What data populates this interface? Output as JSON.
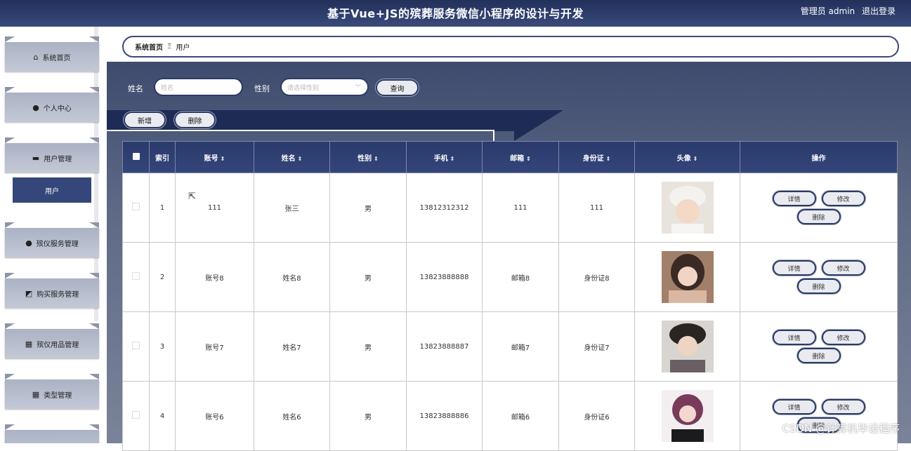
{
  "header": {
    "title": "基于Vue+JS的殡葬服务微信小程序的设计与开发",
    "user_label": "管理员 admin",
    "logout_label": "退出登录"
  },
  "sidebar": {
    "items": [
      {
        "label": "系统首页",
        "icon": "home-icon"
      },
      {
        "label": "个人中心",
        "icon": "user-icon"
      },
      {
        "label": "用户管理",
        "icon": "briefcase-icon"
      },
      {
        "label": "殡仪服务管理",
        "icon": "user-icon"
      },
      {
        "label": "购买服务管理",
        "icon": "chart-icon"
      },
      {
        "label": "殡仪用品管理",
        "icon": "grid-icon"
      },
      {
        "label": "类型管理",
        "icon": "grid-icon"
      }
    ],
    "sub_item": "用户"
  },
  "breadcrumb": {
    "home": "系统首页",
    "separator": "Ξ",
    "current": "用户"
  },
  "search": {
    "name_label": "姓名",
    "name_placeholder": "姓名",
    "gender_label": "性别",
    "gender_placeholder": "请选择性别",
    "query_button": "查询"
  },
  "toolbar": {
    "add": "新增",
    "delete": "删除"
  },
  "table": {
    "columns": [
      "索引",
      "账号",
      "姓名",
      "性别",
      "手机",
      "邮箱",
      "身份证",
      "头像",
      "操作"
    ],
    "rows": [
      {
        "index": "1",
        "account": "111",
        "name": "张三",
        "gender": "男",
        "phone": "13812312312",
        "email": "111",
        "id_card": "111"
      },
      {
        "index": "2",
        "account": "账号8",
        "name": "姓名8",
        "gender": "男",
        "phone": "13823888888",
        "email": "邮箱8",
        "id_card": "身份证8"
      },
      {
        "index": "3",
        "account": "账号7",
        "name": "姓名7",
        "gender": "男",
        "phone": "13823888887",
        "email": "邮箱7",
        "id_card": "身份证7"
      },
      {
        "index": "4",
        "account": "账号6",
        "name": "姓名6",
        "gender": "男",
        "phone": "13823888886",
        "email": "邮箱6",
        "id_card": "身份证6"
      }
    ],
    "row_actions": {
      "detail": "详情",
      "edit": "修改",
      "delete": "删除"
    }
  },
  "watermark": "CSDN @计算机毕设程序",
  "colors": {
    "header_bg": "#2f3f6e",
    "accent": "#34467a",
    "sidebar_item": "#b9c0cf"
  }
}
